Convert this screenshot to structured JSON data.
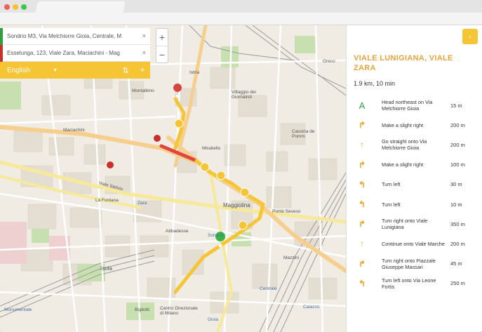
{
  "search": {
    "from_value": "Sondrio M3, Via Melchiorre Gioia, Centrale, M",
    "to_value": "Esselunga, 123, Viale Zara, Maciachini - Mag",
    "clear_symbol": "×",
    "start_color": "#2e9e3f",
    "end_color": "#c8302c"
  },
  "controls": {
    "language": "English",
    "swap_icon": "swap-vertical-icon",
    "add_icon": "plus-icon"
  },
  "zoom": {
    "in": "+",
    "out": "−"
  },
  "map_labels": {
    "istria": "Istria",
    "montalbino": "Montalbino",
    "villaggio": "Villaggio dei Giornalisti",
    "greco": "Greco",
    "cassina": "Cassina de Pomm",
    "maciachini": "Maciachini",
    "mirabello": "Mirabello",
    "viale_stelvio": "Viale Stelvio",
    "la_fontana": "La Fontana",
    "zara": "Zara",
    "maggiolina": "Maggiolina",
    "ponte_seveso": "Ponte Seveso",
    "sondrio": "Sondrio",
    "isola": "Isola",
    "abbadesse": "Abbadesse",
    "centrale": "Centrale",
    "monumentale": "Monumentale",
    "centro_direzionale": "Centro Direzionale di Milano",
    "gioia": "Gioia",
    "caiazzo": "Caiazzo",
    "mazzini": "Mazzini",
    "bigliotti": "Bigliotti"
  },
  "directions": {
    "collapse_symbol": "›",
    "title": "VIALE LUNIGIANA, VIALE ZARA",
    "summary": "1.9 km, 10 min",
    "steps": [
      {
        "icon": "start-A-icon",
        "symbol": "A",
        "text": "Head northeast on Via Melchiorre Gioia",
        "dist": "15 m"
      },
      {
        "icon": "slight-right-icon",
        "symbol": "↱",
        "text": "Make a slight right",
        "dist": "200 m"
      },
      {
        "icon": "straight-icon",
        "symbol": "↑",
        "text": "Go straight onto Via Melchiorre Gioia",
        "dist": "200 m"
      },
      {
        "icon": "slight-right-icon",
        "symbol": "↱",
        "text": "Make a slight right",
        "dist": "100 m"
      },
      {
        "icon": "turn-left-icon",
        "symbol": "↰",
        "text": "Turn left",
        "dist": "30 m"
      },
      {
        "icon": "turn-left-icon",
        "symbol": "↰",
        "text": "Turn left",
        "dist": "10 m"
      },
      {
        "icon": "turn-right-icon",
        "symbol": "↱",
        "text": "Turn right onto Viale Lunigiana",
        "dist": "350 m"
      },
      {
        "icon": "straight-icon",
        "symbol": "↑",
        "text": "Continue onto Viale Marche",
        "dist": "200 m"
      },
      {
        "icon": "turn-right-icon",
        "symbol": "↱",
        "text": "Turn right onto Piazzale Giuseppe Massari",
        "dist": "45 m"
      },
      {
        "icon": "turn-left-icon",
        "symbol": "↰",
        "text": "Turn left onto Via Leone Fortis",
        "dist": "250 m"
      }
    ]
  },
  "colors": {
    "accent": "#f5c536",
    "title": "#e8a33c",
    "route": "#f5c536",
    "route_red": "#e0453e",
    "start_marker": "#3bb54a",
    "end_marker": "#d64541"
  }
}
